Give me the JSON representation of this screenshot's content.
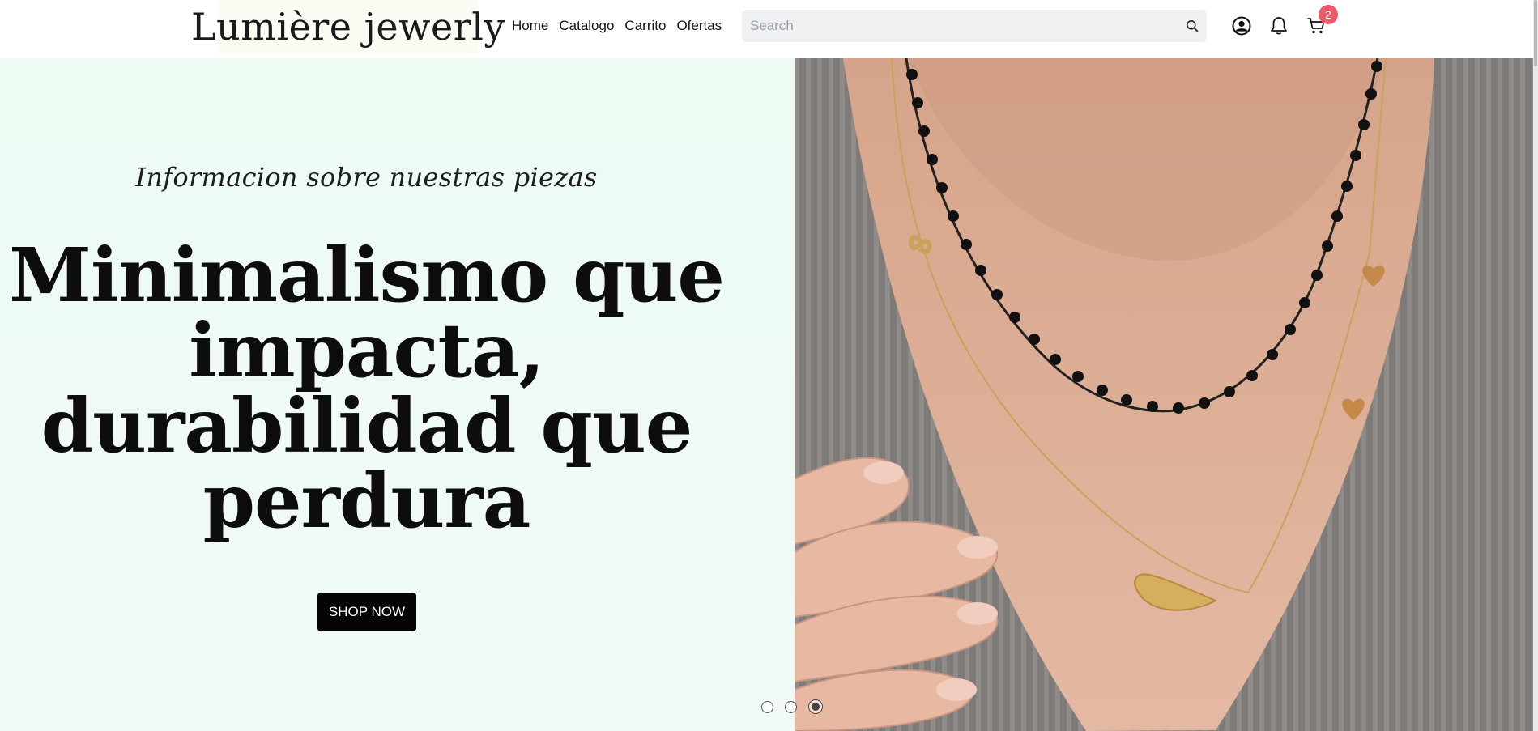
{
  "brand": {
    "logo_text": "Lumière jewerly"
  },
  "nav": {
    "items": [
      "Home",
      "Catalogo",
      "Carrito",
      "Ofertas"
    ]
  },
  "search": {
    "placeholder": "Search",
    "value": ""
  },
  "header_icons": {
    "account": "user-circle-icon",
    "notifications": "bell-icon",
    "cart": "cart-icon",
    "cart_count": "2",
    "badge_color": "#ef5a6a"
  },
  "hero": {
    "subtitle": "Informacion sobre nuestras piezas",
    "headline_lines": [
      "Minimalismo que",
      "impacta,",
      "durabilidad que",
      "perdura"
    ],
    "cta_label": "SHOP NOW",
    "image_description": "necklace-photo",
    "background_color": "#edfbf3"
  },
  "carousel": {
    "slides": 3,
    "active_index": 2
  }
}
